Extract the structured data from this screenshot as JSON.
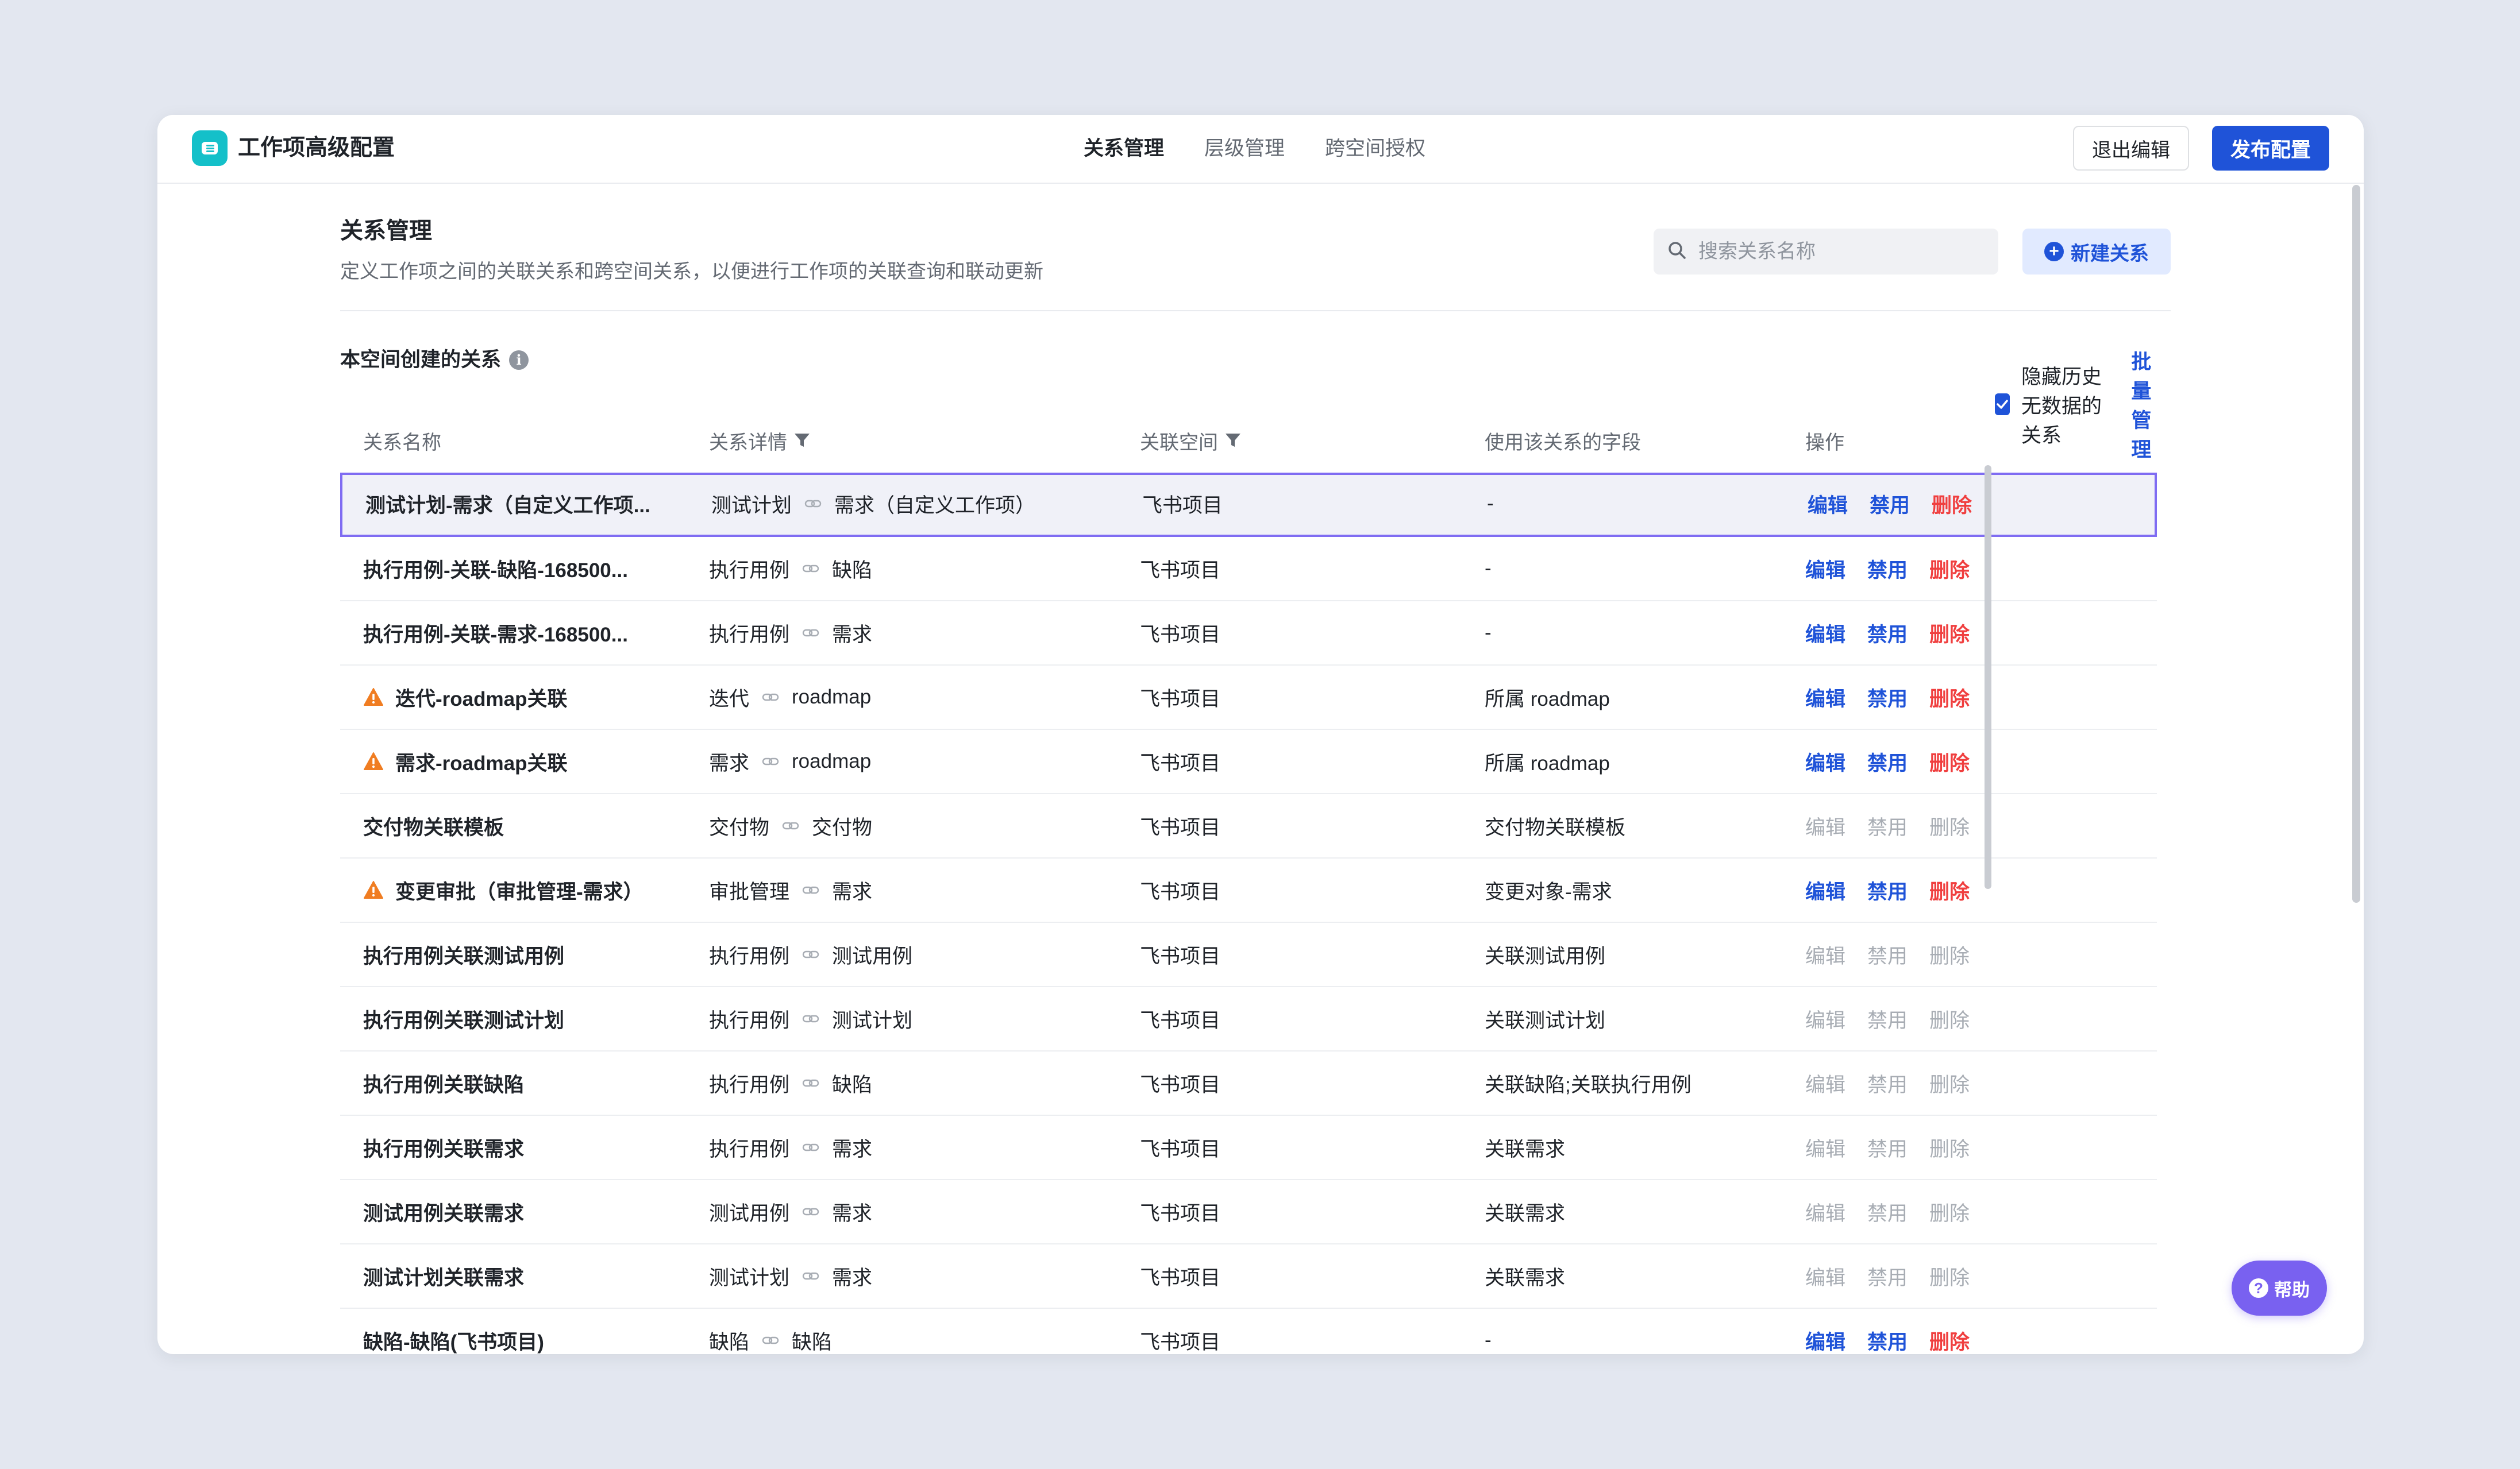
{
  "app": {
    "title": "工作项高级配置"
  },
  "tabs": [
    {
      "label": "关系管理",
      "active": true
    },
    {
      "label": "层级管理",
      "active": false
    },
    {
      "label": "跨空间授权",
      "active": false
    }
  ],
  "header_actions": {
    "exit_label": "退出编辑",
    "publish_label": "发布配置"
  },
  "section": {
    "title": "关系管理",
    "description": "定义工作项之间的关联关系和跨空间关系，以便进行工作项的关联查询和联动更新",
    "search_placeholder": "搜索关系名称",
    "new_label": "新建关系"
  },
  "subsection": {
    "title": "本空间创建的关系",
    "hide_label": "隐藏历史无数据的关系",
    "hide_checked": true,
    "batch_label": "批量管理"
  },
  "columns": [
    "关系名称",
    "关系详情",
    "关联空间",
    "使用该关系的字段",
    "操作"
  ],
  "actions": {
    "edit": "编辑",
    "disable": "禁用",
    "delete": "删除"
  },
  "rows": [
    {
      "name": "测试计划-需求（自定义工作项...",
      "from": "测试计划",
      "to": "需求（自定义工作项）",
      "space": "飞书项目",
      "field": "-",
      "warn": false,
      "editable": true,
      "selected": true
    },
    {
      "name": "执行用例-关联-缺陷-168500...",
      "from": "执行用例",
      "to": "缺陷",
      "space": "飞书项目",
      "field": "-",
      "warn": false,
      "editable": true
    },
    {
      "name": "执行用例-关联-需求-168500...",
      "from": "执行用例",
      "to": "需求",
      "space": "飞书项目",
      "field": "-",
      "warn": false,
      "editable": true
    },
    {
      "name": "迭代-roadmap关联",
      "from": "迭代",
      "to": "roadmap",
      "space": "飞书项目",
      "field": "所属 roadmap",
      "warn": true,
      "editable": true
    },
    {
      "name": "需求-roadmap关联",
      "from": "需求",
      "to": "roadmap",
      "space": "飞书项目",
      "field": "所属 roadmap",
      "warn": true,
      "editable": true
    },
    {
      "name": "交付物关联模板",
      "from": "交付物",
      "to": "交付物",
      "space": "飞书项目",
      "field": "交付物关联模板",
      "warn": false,
      "editable": false
    },
    {
      "name": "变更审批（审批管理-需求）",
      "from": "审批管理",
      "to": "需求",
      "space": "飞书项目",
      "field": "变更对象-需求",
      "warn": true,
      "editable": true
    },
    {
      "name": "执行用例关联测试用例",
      "from": "执行用例",
      "to": "测试用例",
      "space": "飞书项目",
      "field": "关联测试用例",
      "warn": false,
      "editable": false
    },
    {
      "name": "执行用例关联测试计划",
      "from": "执行用例",
      "to": "测试计划",
      "space": "飞书项目",
      "field": "关联测试计划",
      "warn": false,
      "editable": false
    },
    {
      "name": "执行用例关联缺陷",
      "from": "执行用例",
      "to": "缺陷",
      "space": "飞书项目",
      "field": "关联缺陷;关联执行用例",
      "warn": false,
      "editable": false
    },
    {
      "name": "执行用例关联需求",
      "from": "执行用例",
      "to": "需求",
      "space": "飞书项目",
      "field": "关联需求",
      "warn": false,
      "editable": false
    },
    {
      "name": "测试用例关联需求",
      "from": "测试用例",
      "to": "需求",
      "space": "飞书项目",
      "field": "关联需求",
      "warn": false,
      "editable": false
    },
    {
      "name": "测试计划关联需求",
      "from": "测试计划",
      "to": "需求",
      "space": "飞书项目",
      "field": "关联需求",
      "warn": false,
      "editable": false
    },
    {
      "name": "缺陷-缺陷(飞书项目)",
      "from": "缺陷",
      "to": "缺陷",
      "space": "飞书项目",
      "field": "-",
      "warn": false,
      "editable": true
    }
  ],
  "help": {
    "label": "帮助"
  },
  "colors": {
    "primary": "#1f53d8",
    "danger": "#f03f3f",
    "warning": "#f07d22",
    "logo": "#14c0c9",
    "help": "#7961f0"
  }
}
